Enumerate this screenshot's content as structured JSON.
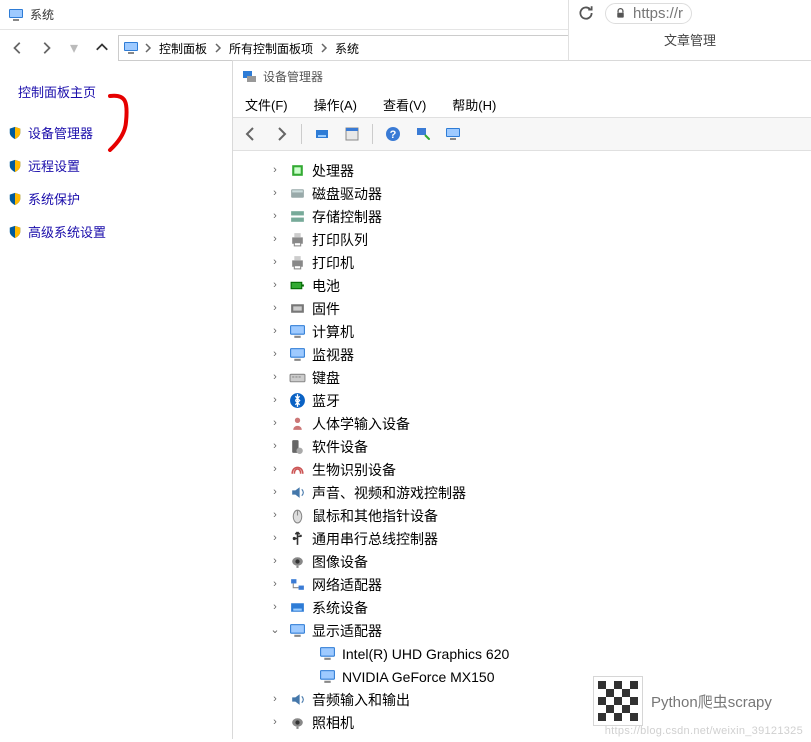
{
  "cp": {
    "title": "系统",
    "breadcrumb": [
      "控制面板",
      "所有控制面板项",
      "系统"
    ],
    "side": {
      "home": "控制面板主页",
      "tasks": [
        "设备管理器",
        "远程设置",
        "系统保护",
        "高级系统设置"
      ]
    }
  },
  "dm": {
    "title": "设备管理器",
    "menu": [
      "文件(F)",
      "操作(A)",
      "查看(V)",
      "帮助(H)"
    ],
    "toolbar": [
      "back",
      "forward",
      "sep",
      "show-hidden",
      "properties",
      "sep",
      "help",
      "scan",
      "monitor"
    ],
    "nodes": [
      {
        "depth": 1,
        "exp": ">",
        "icon": "cpu",
        "label": "处理器"
      },
      {
        "depth": 1,
        "exp": ">",
        "icon": "disk",
        "label": "磁盘驱动器"
      },
      {
        "depth": 1,
        "exp": ">",
        "icon": "storage",
        "label": "存储控制器"
      },
      {
        "depth": 1,
        "exp": ">",
        "icon": "printq",
        "label": "打印队列"
      },
      {
        "depth": 1,
        "exp": ">",
        "icon": "printer",
        "label": "打印机"
      },
      {
        "depth": 1,
        "exp": ">",
        "icon": "battery",
        "label": "电池"
      },
      {
        "depth": 1,
        "exp": ">",
        "icon": "firmware",
        "label": "固件"
      },
      {
        "depth": 1,
        "exp": ">",
        "icon": "computer",
        "label": "计算机"
      },
      {
        "depth": 1,
        "exp": ">",
        "icon": "monitor",
        "label": "监视器"
      },
      {
        "depth": 1,
        "exp": ">",
        "icon": "keyboard",
        "label": "键盘"
      },
      {
        "depth": 1,
        "exp": ">",
        "icon": "bluetooth",
        "label": "蓝牙"
      },
      {
        "depth": 1,
        "exp": ">",
        "icon": "hid",
        "label": "人体学输入设备"
      },
      {
        "depth": 1,
        "exp": ">",
        "icon": "software",
        "label": "软件设备"
      },
      {
        "depth": 1,
        "exp": ">",
        "icon": "biometric",
        "label": "生物识别设备"
      },
      {
        "depth": 1,
        "exp": ">",
        "icon": "audio",
        "label": "声音、视频和游戏控制器"
      },
      {
        "depth": 1,
        "exp": ">",
        "icon": "mouse",
        "label": "鼠标和其他指针设备"
      },
      {
        "depth": 1,
        "exp": ">",
        "icon": "usb",
        "label": "通用串行总线控制器"
      },
      {
        "depth": 1,
        "exp": ">",
        "icon": "imaging",
        "label": "图像设备"
      },
      {
        "depth": 1,
        "exp": ">",
        "icon": "network",
        "label": "网络适配器"
      },
      {
        "depth": 1,
        "exp": ">",
        "icon": "system",
        "label": "系统设备"
      },
      {
        "depth": 1,
        "exp": "v",
        "icon": "display",
        "label": "显示适配器"
      },
      {
        "depth": 2,
        "exp": "",
        "icon": "gpu",
        "label": "Intel(R) UHD Graphics 620"
      },
      {
        "depth": 2,
        "exp": "",
        "icon": "gpu",
        "label": "NVIDIA GeForce MX150"
      },
      {
        "depth": 1,
        "exp": ">",
        "icon": "audioio",
        "label": "音频输入和输出"
      },
      {
        "depth": 1,
        "exp": ">",
        "icon": "camera",
        "label": "照相机"
      }
    ]
  },
  "browser": {
    "url": "https://r",
    "tab": "文章管理"
  },
  "wechat": {
    "label": "Python爬虫scrapy"
  },
  "watermark": "https://blog.csdn.net/weixin_39121325"
}
